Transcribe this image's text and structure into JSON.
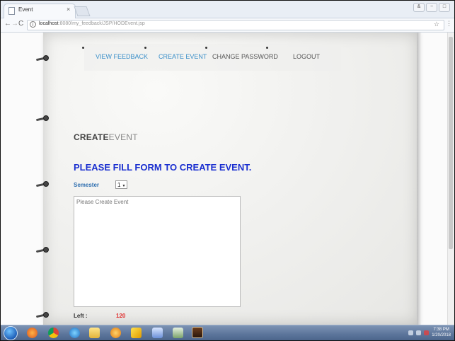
{
  "browser": {
    "tab_title": "Event",
    "tab_close": "×",
    "url_host": "localhost",
    "url_rest": ":8080/my_feedback/JSP/HODEvent.jsp",
    "window_buttons": [
      "&",
      "−",
      "□"
    ],
    "nav": {
      "back": "←",
      "forward": "→",
      "reload": "C"
    }
  },
  "menu": {
    "items": [
      {
        "label": "VIEW FEEDBACK"
      },
      {
        "label": "CREATE EVENT"
      },
      {
        "label": "CHANGE PASSWORD"
      },
      {
        "label": "LOGOUT"
      }
    ]
  },
  "page": {
    "title_bold": "CREATE",
    "title_light": "EVENT",
    "form_heading": "PLEASE FILL FORM TO CREATE EVENT.",
    "semester_label": "Semester",
    "semester_value": "1",
    "event_placeholder": "Please Create Event",
    "left_label": "Left :",
    "left_count": "120"
  },
  "taskbar": {
    "clock_time": "7:38 PM",
    "clock_date": "1/20/2018"
  },
  "colors": {
    "menu_link": "#3a8fc9",
    "form_heading": "#1a2fd0",
    "label_blue": "#2f6fb0",
    "counter_red": "#e03030"
  }
}
